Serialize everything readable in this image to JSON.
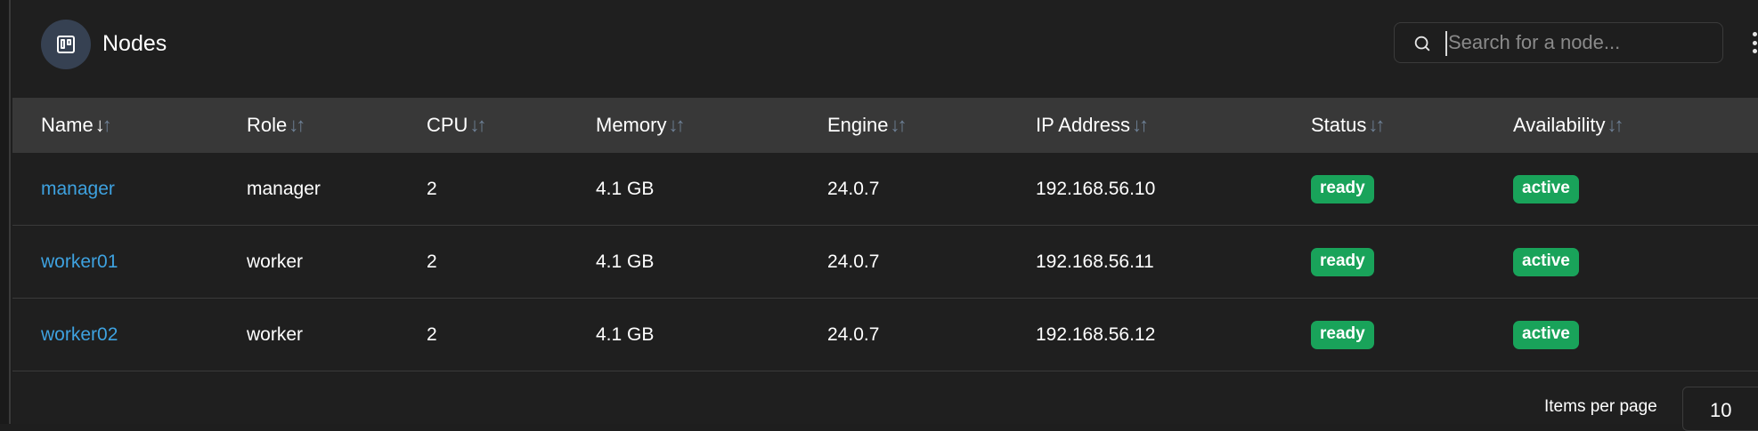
{
  "header": {
    "title": "Nodes",
    "icon": "nodes-board-icon"
  },
  "search": {
    "placeholder": "Search for a node...",
    "value": ""
  },
  "table": {
    "columns": [
      "Name",
      "Role",
      "CPU",
      "Memory",
      "Engine",
      "IP Address",
      "Status",
      "Availability"
    ],
    "rows": [
      {
        "name": "manager",
        "role": "manager",
        "cpu": "2",
        "memory": "4.1 GB",
        "engine": "24.0.7",
        "ip": "192.168.56.10",
        "status": "ready",
        "availability": "active"
      },
      {
        "name": "worker01",
        "role": "worker",
        "cpu": "2",
        "memory": "4.1 GB",
        "engine": "24.0.7",
        "ip": "192.168.56.11",
        "status": "ready",
        "availability": "active"
      },
      {
        "name": "worker02",
        "role": "worker",
        "cpu": "2",
        "memory": "4.1 GB",
        "engine": "24.0.7",
        "ip": "192.168.56.12",
        "status": "ready",
        "availability": "active"
      }
    ]
  },
  "pagination": {
    "items_per_page_label": "Items per page",
    "items_per_page_value": "10"
  },
  "colors": {
    "link": "#3ea2e0",
    "badge_green": "#19a35a",
    "header_row": "#383838",
    "background": "#1f1f1f"
  }
}
